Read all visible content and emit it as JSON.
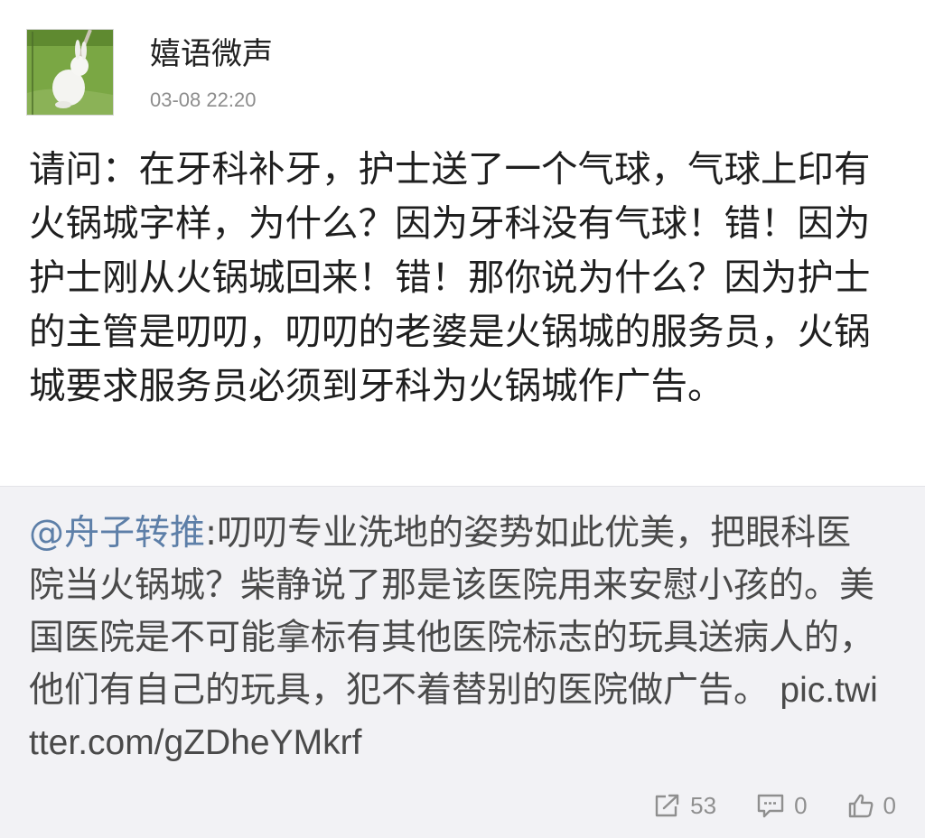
{
  "post": {
    "author": "嬉语微声",
    "time": "03-08 22:20",
    "avatar_icon": "avatar-white-rabbit-on-grass",
    "text": "请问：在牙科补牙，护士送了一个气球，气球上印有火锅城字样，为什么？因为牙科没有气球！错！因为护士刚从火锅城回来！错！那你说为什么？因为护士的主管是叨叨，叨叨的老婆是火锅城的服务员，火锅城要求服务员必须到牙科为火锅城作广告。"
  },
  "retweet": {
    "user": "@舟子转推",
    "separator": ":",
    "text": "叨叨专业洗地的姿势如此优美，把眼科医院当火锅城？柴静说了那是该医院用来安慰小孩的。美国医院是不可能拿标有其他医院标志的玩具送病人的，他们有自己的玩具，犯不着替别的医院做广告。 ",
    "link": "pic.twitter.com/gZDheYMkrf"
  },
  "actions": {
    "repost": {
      "icon": "share-icon",
      "count": "53"
    },
    "comment": {
      "icon": "comment-icon",
      "count": "0"
    },
    "like": {
      "icon": "thumbs-up-icon",
      "count": "0"
    }
  },
  "colors": {
    "background": "#ffffff",
    "retweet_background": "#f2f2f5",
    "mention": "#5d7fa8",
    "muted": "#8f8f8f"
  }
}
